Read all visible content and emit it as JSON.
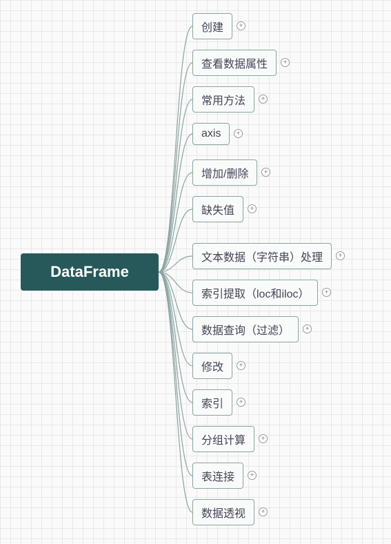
{
  "root": {
    "label": "DataFrame"
  },
  "children": [
    {
      "label": "创建"
    },
    {
      "label": "查看数据属性"
    },
    {
      "label": "常用方法"
    },
    {
      "label": "axis"
    },
    {
      "label": "增加/删除"
    },
    {
      "label": "缺失值"
    },
    {
      "label": "文本数据（字符串）处理"
    },
    {
      "label": "索引提取（loc和iloc）"
    },
    {
      "label": "数据查询（过滤）"
    },
    {
      "label": "修改"
    },
    {
      "label": "索引"
    },
    {
      "label": "分组计算"
    },
    {
      "label": "表连接"
    },
    {
      "label": "数据透视"
    }
  ],
  "colors": {
    "rootBg": "#27595a",
    "nodeBorder": "#8aa3a0",
    "nodeBg": "#f9fbfb"
  }
}
